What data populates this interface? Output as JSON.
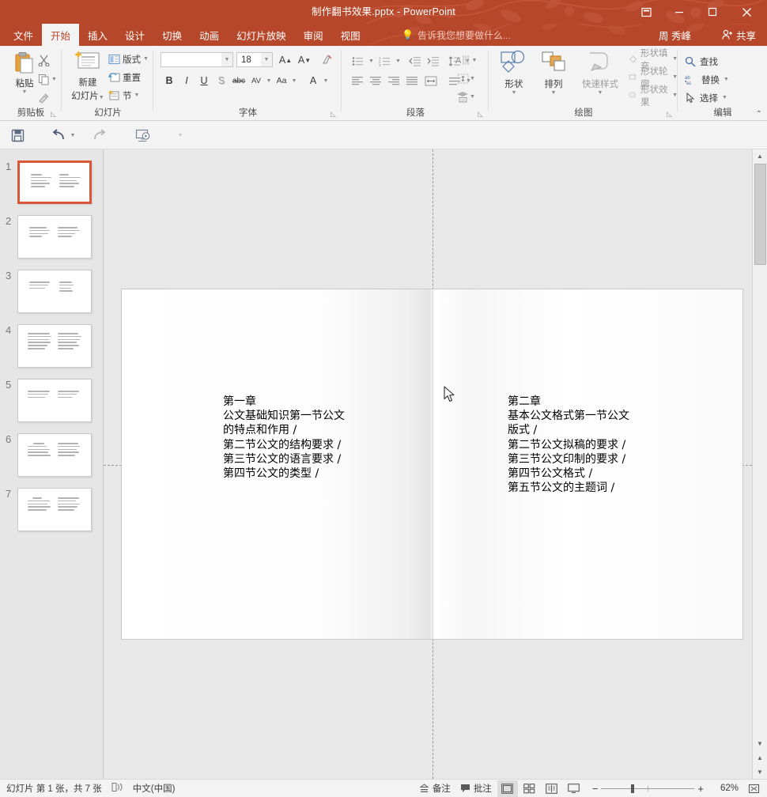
{
  "titlebar": {
    "document_title": "制作翻书效果.pptx - PowerPoint",
    "ribbon_display_icon": "ribbon-display-options-icon",
    "minimize": "—",
    "maximize": "▢",
    "close": "✕"
  },
  "tabs": [
    {
      "label": "文件",
      "active": false
    },
    {
      "label": "开始",
      "active": true
    },
    {
      "label": "插入",
      "active": false
    },
    {
      "label": "设计",
      "active": false
    },
    {
      "label": "切换",
      "active": false
    },
    {
      "label": "动画",
      "active": false
    },
    {
      "label": "幻灯片放映",
      "active": false
    },
    {
      "label": "审阅",
      "active": false
    },
    {
      "label": "视图",
      "active": false
    }
  ],
  "tellme": {
    "placeholder": "告诉我您想要做什么...",
    "icon": "lightbulb-icon"
  },
  "account": {
    "name": "周 秀峰"
  },
  "share": {
    "label": "共享",
    "icon": "share-person-icon"
  },
  "ribbon": {
    "clipboard": {
      "group_label": "剪贴板",
      "paste_label": "粘贴",
      "cut_label": "剪切",
      "copy_label": "复制",
      "format_painter_label": "格式刷"
    },
    "slides": {
      "group_label": "幻灯片",
      "new_slide_line1": "新建",
      "new_slide_line2": "幻灯片",
      "layout_label": "版式",
      "reset_label": "重置",
      "section_label": "节"
    },
    "font": {
      "group_label": "字体",
      "font_name_value": "",
      "font_size_value": "18",
      "grow_font": "A",
      "shrink_font": "A",
      "clear_formatting": "clear-formatting-icon",
      "bold": "B",
      "italic": "I",
      "underline": "U",
      "shadow": "S",
      "strikethrough": "abc",
      "character_spacing": "AV",
      "change_case": "Aa",
      "font_color": "A"
    },
    "paragraph": {
      "group_label": "段落"
    },
    "drawing": {
      "group_label": "绘图",
      "shapes_label": "形状",
      "arrange_label": "排列",
      "quick_styles_label": "快速样式",
      "shape_fill_label": "形状填充",
      "shape_outline_label": "形状轮廓",
      "shape_effects_label": "形状效果"
    },
    "editing": {
      "group_label": "编辑",
      "find_label": "查找",
      "replace_label": "替换",
      "select_label": "选择",
      "find_icon": "magnifier-icon",
      "replace_icon": "replace-ab-icon",
      "select_icon": "pointer-arrow-icon",
      "collapse_icon": "chevron-up-icon"
    }
  },
  "quick_access": [
    {
      "name": "save",
      "icon": "floppy-disk-icon"
    },
    {
      "name": "undo",
      "icon": "undo-arrow-icon"
    },
    {
      "name": "undo-dropdown",
      "icon": "chevron-down-icon"
    },
    {
      "name": "redo",
      "icon": "redo-arrow-icon"
    },
    {
      "name": "start-slideshow",
      "icon": "slideshow-play-icon"
    },
    {
      "name": "customize-qat",
      "icon": "chevron-down-icon"
    }
  ],
  "thumbnails": [
    {
      "number": "1",
      "selected": true
    },
    {
      "number": "2",
      "selected": false
    },
    {
      "number": "3",
      "selected": false
    },
    {
      "number": "4",
      "selected": false
    },
    {
      "number": "5",
      "selected": false
    },
    {
      "number": "6",
      "selected": false
    },
    {
      "number": "7",
      "selected": false
    }
  ],
  "slide": {
    "left_page_text": "第一章\n公文基础知识第一节公文\n的特点和作用 /\n第二节公文的结构要求 /\n第三节公文的语言要求 /\n第四节公文的类型 /",
    "right_page_text": "第二章\n基本公文格式第一节公文\n版式 /\n第二节公文拟稿的要求 /\n第三节公文印制的要求 /\n第四节公文格式 /\n第五节公文的主题词 /"
  },
  "statusbar": {
    "slide_counter": "幻灯片 第 1 张，共 7 张",
    "accessibility_icon": "accessibility-check-icon",
    "language": "中文(中国)",
    "notes_label": "备注",
    "notes_icon": "notes-icon",
    "comments_label": "批注",
    "comments_icon": "comment-bubble-icon",
    "views": [
      {
        "name": "normal-view",
        "icon": "normal-view-icon",
        "active": true
      },
      {
        "name": "slide-sorter-view",
        "icon": "sorter-view-icon",
        "active": false
      },
      {
        "name": "reading-view",
        "icon": "reading-view-icon",
        "active": false
      },
      {
        "name": "slideshow-view",
        "icon": "slideshow-view-icon",
        "active": false
      }
    ],
    "zoom_out": "−",
    "zoom_in": "+",
    "zoom_percent": "62%",
    "fit_to_window_icon": "fit-slide-icon"
  },
  "colors": {
    "brand": "#b7472a",
    "ribbon_bg": "#f3f3f3",
    "selection": "#d9583a",
    "canvas_bg": "#e8e8e8"
  }
}
